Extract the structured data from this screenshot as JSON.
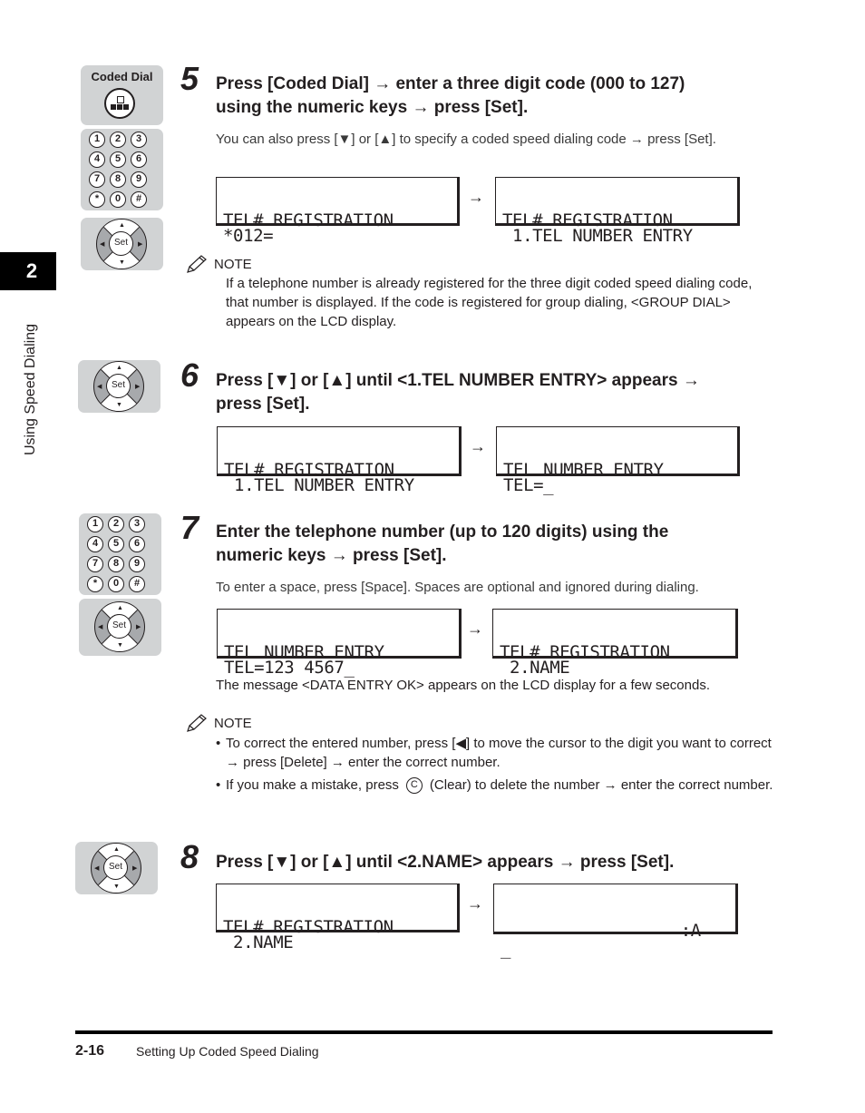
{
  "sidebar": {
    "chapter_number": "2",
    "chapter_title": "Using Speed Dialing"
  },
  "keys": {
    "coded_dial_label": "Coded Dial",
    "numpad_rows": [
      [
        "1",
        "2",
        "3"
      ],
      [
        "4",
        "5",
        "6"
      ],
      [
        "7",
        "8",
        "9"
      ],
      [
        "*",
        "0",
        "#"
      ]
    ],
    "set_label": "Set",
    "up_arrow": "▲",
    "down_arrow": "▼",
    "left_arrow": "◀",
    "right_arrow": "▶"
  },
  "steps": [
    {
      "number": "5",
      "title_line1": "Press [Coded Dial] → enter a three digit code (000 to 127)",
      "title_line2": "using the numeric keys → press [Set].",
      "body": "You can also press [▼] or [▲] to specify a coded speed dialing code → press [Set].",
      "lcd_before": [
        "TEL# REGISTRATION",
        "*012="
      ],
      "lcd_after": [
        "TEL# REGISTRATION",
        " 1.TEL NUMBER ENTRY"
      ],
      "note": {
        "label": "NOTE",
        "text": "If a telephone number is already registered for the three digit coded speed dialing code, that number is displayed. If the code is registered for group dialing, <GROUP DIAL> appears on the LCD display."
      }
    },
    {
      "number": "6",
      "title_line1": "Press [▼] or [▲] until <1.TEL NUMBER ENTRY> appears →",
      "title_line2": "press [Set].",
      "lcd_before": [
        "TEL# REGISTRATION",
        " 1.TEL NUMBER ENTRY"
      ],
      "lcd_after": [
        "TEL NUMBER ENTRY",
        "TEL=_"
      ]
    },
    {
      "number": "7",
      "title_line1": "Enter the telephone number (up to 120 digits) using the",
      "title_line2": "numeric keys → press [Set].",
      "body": "To enter a space, press [Space]. Spaces are optional and ignored during dialing.",
      "lcd_before": [
        "TEL NUMBER ENTRY",
        "TEL=123 4567_"
      ],
      "lcd_after": [
        "TEL# REGISTRATION",
        " 2.NAME"
      ],
      "after_text": "The message <DATA ENTRY OK> appears on the LCD display for a few seconds.",
      "note": {
        "label": "NOTE",
        "bullet1": "To correct the entered number, press [◀] to move the cursor to the digit you want to correct → press [Delete] → enter the correct number.",
        "bullet2_before": "If you make a mistake, press",
        "clear_key": "C",
        "bullet2_after": "(Clear) to delete the number → enter the correct number."
      }
    },
    {
      "number": "8",
      "title_line1": "Press [▼] or [▲] until <2.NAME> appears → press [Set].",
      "lcd_before": [
        "TEL# REGISTRATION",
        " 2.NAME"
      ],
      "lcd_after": [
        "                  :A",
        "_"
      ]
    }
  ],
  "arrow_symbol": "→",
  "footer": {
    "page_number": "2-16",
    "section_title": "Setting Up Coded Speed Dialing"
  }
}
